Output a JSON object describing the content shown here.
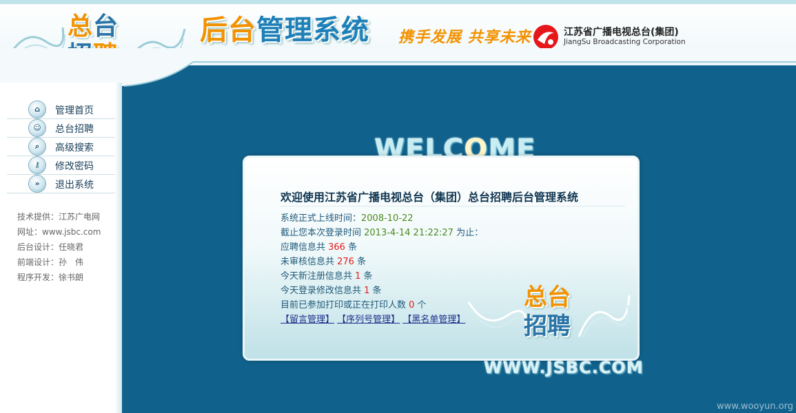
{
  "header": {
    "logo_line1_a": "总",
    "logo_line1_b": "台",
    "logo_line2_a": "招",
    "logo_line2_b": "聘",
    "title_a": "后台",
    "title_b": "管理系统",
    "slogan": "携手发展  共享未来",
    "corp_cn": "江苏省广播电视总台(集团)",
    "corp_en": "JiangSu Broadcasting Corporation"
  },
  "sidebar": {
    "items": [
      {
        "label": "管理首页",
        "icon": "home-icon",
        "glyph": "⌂"
      },
      {
        "label": "总台招聘",
        "icon": "people-icon",
        "glyph": "☺"
      },
      {
        "label": "高级搜索",
        "icon": "search-icon",
        "glyph": "⌕"
      },
      {
        "label": "修改密码",
        "icon": "key-icon",
        "glyph": "⚷"
      },
      {
        "label": "退出系统",
        "icon": "exit-icon",
        "glyph": "»"
      }
    ],
    "credits": [
      "技术提供：江苏广电网",
      "网址：www.jsbc.com",
      "后台设计：任晓君",
      "前端设计：孙　伟",
      "程序开发：徐书朗"
    ]
  },
  "main": {
    "welcome_a": "WELC",
    "welcome_b": "O",
    "welcome_c": "ME",
    "title": "欢迎使用江苏省广播电视总台（集团）总台招聘后台管理系统",
    "online_label": "系统正式上线时间：",
    "online_date": "2008-10-22",
    "login_label": "截止您本次登录时间 ",
    "login_time": "2013-4-14 21:22:27",
    "login_suffix": " 为止：",
    "apply_label": "应聘信息共 ",
    "apply_count": "366",
    "apply_unit": " 条",
    "unreviewed_label": "未审核信息共 ",
    "unreviewed_count": "276",
    "unreviewed_unit": " 条",
    "newreg_label": "今天新注册信息共 ",
    "newreg_count": "1",
    "newreg_unit": " 条",
    "modify_label": "今天登录修改信息共 ",
    "modify_count": "1",
    "modify_unit": " 条",
    "print_label": "目前已参加打印或正在打印人数 ",
    "print_count": "0",
    "print_unit": " 个",
    "link_messages": "【留言管理】",
    "link_serial": "【序列号管理】",
    "link_blacklist": "【黑名单管理】",
    "card_logo_a": "总台",
    "card_logo_b": "招聘",
    "site_url": "WWW.JSBC.COM"
  },
  "watermark": "www.wooyun.org",
  "colors": {
    "background": "#10628c",
    "accent_orange": "#f39200",
    "accent_blue": "#1d80b8",
    "value_green": "#4a8a1e",
    "value_red": "#e31b1b"
  }
}
